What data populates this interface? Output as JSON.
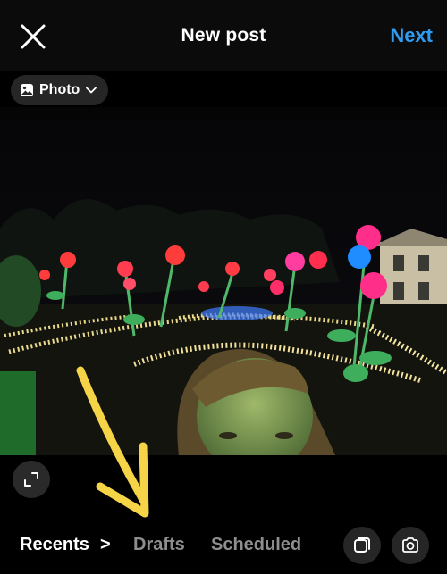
{
  "header": {
    "title": "New post",
    "next_label": "Next",
    "close_icon": "close-icon"
  },
  "post_type": {
    "label": "Photo",
    "icon": "photo-icon",
    "dropdown_icon": "chevron-down-icon"
  },
  "gallery": {
    "tabs": [
      {
        "label": "Recents",
        "active": true
      },
      {
        "label": "Drafts",
        "active": false
      },
      {
        "label": "Scheduled",
        "active": false
      }
    ],
    "recents_chevron": ">",
    "multi_select_icon": "multi-select-icon",
    "camera_icon": "camera-icon",
    "expand_icon": "expand-icon"
  },
  "colors": {
    "accent": "#2f9bf1",
    "background": "#000000",
    "inactive_tab": "#8e8e8e",
    "annotation_arrow": "#f5d547"
  }
}
